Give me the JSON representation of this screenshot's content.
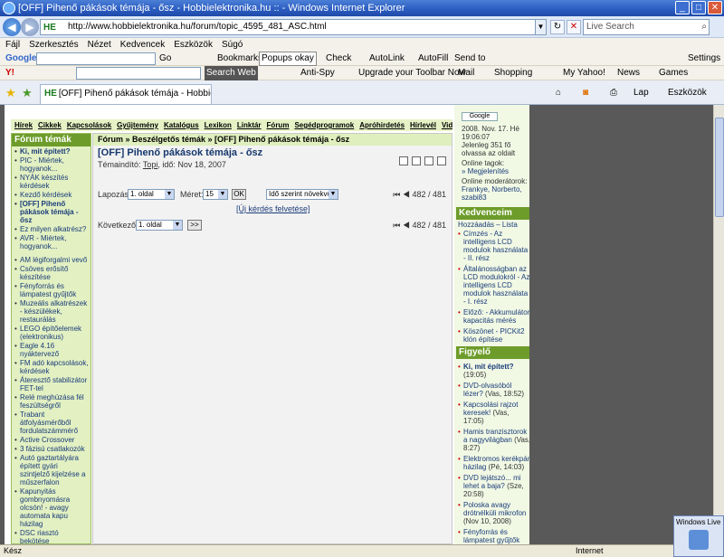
{
  "window": {
    "title": "[OFF] Pihenő pákások témája - ősz - Hobbielektronika.hu :: - Windows Internet Explorer"
  },
  "address": {
    "url": "http://www.hobbielektronika.hu/forum/topic_4595_481_ASC.html",
    "search_placeholder": "Live Search"
  },
  "menu": [
    "Fájl",
    "Szerkesztés",
    "Nézet",
    "Kedvencek",
    "Eszközök",
    "Súgó"
  ],
  "toolbar1": {
    "google": "Google",
    "go": "Go",
    "bookmarks": "Bookmarks",
    "popups": "Popups okay",
    "check": "Check",
    "autolink": "AutoLink",
    "autofill": "AutoFill",
    "sendto": "Send to",
    "settings": "Settings"
  },
  "toolbar2": {
    "search_web": "Search Web",
    "antispy": "Anti-Spy",
    "upgrade": "Upgrade your Toolbar Now",
    "mail": "Mail",
    "shopping": "Shopping",
    "myyahoo": "My Yahoo!",
    "news": "News",
    "games": "Games"
  },
  "tab": {
    "label": "[OFF] Pihenő pákások témája - Hobbielektronika...",
    "lap": "Lap",
    "eszkozok": "Eszközök"
  },
  "nav": [
    "Hírek",
    "Cikkek",
    "Kapcsolások",
    "Gyűjtemény",
    "Katalógus",
    "Lexikon",
    "Linktár",
    "Fórum",
    "Segédprogramok",
    "Apróhirdetés",
    "Hírlevél",
    "Videó"
  ],
  "sidebar": {
    "heading": "Fórum témák",
    "items": [
      {
        "label": "Ki, mit épített?",
        "bold": true
      },
      {
        "label": "PIC - Miértek, hogyanok..."
      },
      {
        "label": "NYÁK készítés kérdések"
      },
      {
        "label": "Kezdő kérdések"
      },
      {
        "label": "[OFF] Pihenő pákások témája - ősz",
        "bold": true
      },
      {
        "label": "Ez milyen alkatrész?"
      },
      {
        "label": "AVR - Miértek, hogyanok..."
      },
      {
        "label": "AM légiforgalmi vevő",
        "sep": true
      },
      {
        "label": "Csöves erősítő készítése"
      },
      {
        "label": "Fényforrás és lámpatest gyűjtők"
      },
      {
        "label": "Muzeális alkatrészek - készülékek, restaurálás"
      },
      {
        "label": "LEGO építőelemek (elektronikus)"
      },
      {
        "label": "Eagle 4.16 nyáktervező"
      },
      {
        "label": "FM adó kapcsolások, kérdések"
      },
      {
        "label": "Áteresztő stabilizátor FET-tel"
      },
      {
        "label": "Relé meghúzása fél feszültségről"
      },
      {
        "label": "Trabant átfolyásmérőből fordulatszámmérő"
      },
      {
        "label": "Active Crossover"
      },
      {
        "label": "3 fázisú csatlakozók"
      },
      {
        "label": "Autó gaztartályára épített gyári szintjelző kijelzése a műszerfalon"
      },
      {
        "label": "Kapunyitás gombnyomásra olcsón! - avagy automata kapu házilag"
      },
      {
        "label": "DSC riasztó bekötése"
      }
    ]
  },
  "main": {
    "breadcrumb": "Fórum » Beszélgetős témák » [OFF] Pihenő pákások témája - ősz",
    "title": "[OFF] Pihenő pákások témája - ősz",
    "meta_prefix": "Témaindító: ",
    "meta_author": "Topi",
    "meta_suffix": ", idő: Nov 18, 2007",
    "lapozas": "Lapozás",
    "page_select": "1. oldal",
    "meret": "Méret:",
    "size_select": "15",
    "ok": "OK",
    "order_select": "Idő szerint növekvő",
    "pager": "482 / 481",
    "new_question": "[Új kérdés felvetése]",
    "kovetkezo": "Következő",
    "next_select": "1. oldal",
    "next_btn": ">>"
  },
  "right": {
    "google_btn": "Google",
    "date": "2008. Nov. 17. Hé 19:06:07",
    "reading": "Jelenleg 351 fő olvassa az oldalt",
    "members_label": "Online tagok:",
    "members_link": "» Megjelenítés",
    "mods_label": "Online moderátorok:",
    "mods": "Frankye, Norberto, szabi83",
    "fav_heading": "Kedvenceim",
    "fav_actions": "Hozzáadás – Lista",
    "favs": [
      "Címzés - Az intelligens LCD modulok használata - II. rész",
      "Általánosságban az LCD modulokról - Az intelligens LCD modulok használata - I. rész",
      "Előző: - Akkumulátor kapacitás mérés",
      "Köszönet - PICKit2 klón építése"
    ],
    "watch_heading": "Figyelő",
    "watch": [
      {
        "title": "Ki, mit épített?",
        "date": "(19:05)"
      },
      {
        "title": "DVD-olvasóból lézer?",
        "date": "(Vas, 18:52)"
      },
      {
        "title": "Kapcsolási rajzot keresek!",
        "date": "(Vas, 17:05)"
      },
      {
        "title": "Hamis tranzisztorok a nagyvilágban",
        "date": "(Vas, 8:27)"
      },
      {
        "title": "Elektromos kerékpár házilag",
        "date": "(Pé, 14:03)"
      },
      {
        "title": "DVD lejátszó... mi lehet a baja?",
        "date": "(Sze, 20:58)"
      },
      {
        "title": "Poloska avagy drótnélküli mikrofon",
        "date": "(Nov 10, 2008)"
      },
      {
        "title": "Fényforrás és lámpatest gyűjtők",
        "date": "(19:00)"
      }
    ]
  },
  "status": {
    "left": "Kész",
    "zone": "Internet",
    "popup_title": "Windows Live"
  }
}
